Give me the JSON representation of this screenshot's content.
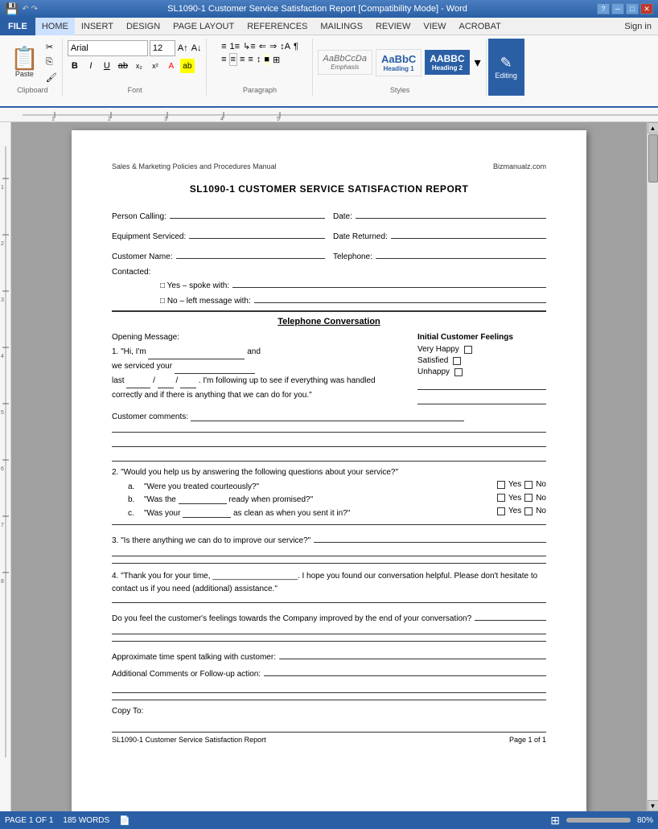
{
  "titlebar": {
    "title": "SL1090-1 Customer Service Satisfaction Report [Compatibility Mode] - Word",
    "help_icon": "?",
    "min_icon": "─",
    "max_icon": "□",
    "close_icon": "✕"
  },
  "menubar": {
    "file": "FILE",
    "tabs": [
      "HOME",
      "INSERT",
      "DESIGN",
      "PAGE LAYOUT",
      "REFERENCES",
      "MAILINGS",
      "REVIEW",
      "VIEW",
      "ACROBAT"
    ],
    "active": "HOME",
    "sign_in": "Sign in"
  },
  "ribbon": {
    "clipboard": {
      "label": "Clipboard",
      "paste": "Paste"
    },
    "font": {
      "label": "Font",
      "name": "Arial",
      "size": "12",
      "bold": "B",
      "italic": "I",
      "underline": "U"
    },
    "paragraph": {
      "label": "Paragraph"
    },
    "styles": {
      "label": "Styles",
      "emphasis": "AaBbCcDa",
      "emphasis_label": "Emphasis",
      "heading1": "AaBbC",
      "heading1_label": "Heading 1",
      "heading2": "AABBC",
      "heading2_label": "Heading 2"
    },
    "editing": {
      "label": "Editing",
      "icon": "✎"
    }
  },
  "document": {
    "header_left": "Sales & Marketing Policies and Procedures Manual",
    "header_right": "Bizmanualz.com",
    "title": "SL1090-1 CUSTOMER SERVICE SATISFACTION REPORT",
    "fields": {
      "person_calling": "Person Calling:",
      "date": "Date:",
      "equipment_serviced": "Equipment Serviced:",
      "date_returned": "Date Returned:",
      "customer_name": "Customer Name:",
      "telephone": "Telephone:",
      "contacted": "Contacted:",
      "yes_spoke": "□ Yes – spoke with:",
      "no_left": "□ No – left message with:"
    },
    "section_title": "Telephone Conversation",
    "opening_message_label": "Opening Message:",
    "opening_message_text": "1. \"Hi, I'm",
    "opening_message_and": "and",
    "opening_message_2": "we serviced your",
    "opening_message_3": "last",
    "opening_message_3b": "/",
    "opening_message_3c": "/",
    "opening_message_4": ". I'm following up to see if everything was handled correctly and if there is anything that we can do for you.\"",
    "initial_feelings_label": "Initial Customer Feelings",
    "feelings": [
      "Very Happy",
      "Satisfied",
      "Unhappy"
    ],
    "customer_comments_label": "Customer comments:",
    "q2_text": "2. \"Would you help us by answering the following questions about your service?\"",
    "sub_questions": [
      {
        "letter": "a.",
        "text": "\"Were you treated courteously?\""
      },
      {
        "letter": "b.",
        "text": "\"Was the ________ ready when promised?\""
      },
      {
        "letter": "c.",
        "text": "\"Was your ________ as clean as when you sent it in?\""
      }
    ],
    "yes_label": "□ Yes",
    "no_label": "□ No",
    "q3_text": "3. \"Is there anything we can do to improve our service?\"",
    "q4_text": "4. \"Thank you for your time, ___________________. I hope you found our conversation helpful. Please don't hesitate to contact us if you need (additional) assistance.\"",
    "feelings_question": "Do you feel the customer's feelings towards the Company improved by the end of your conversation?",
    "approx_time": "Approximate time spent talking with customer:",
    "additional_comments": "Additional Comments or Follow-up action:",
    "copy_to": "Copy To:",
    "footer_left": "SL1090-1 Customer Service Satisfaction Report",
    "footer_right": "Page 1 of 1"
  },
  "statusbar": {
    "page_info": "PAGE 1 OF 1",
    "word_count": "185 WORDS",
    "zoom": "80%"
  }
}
